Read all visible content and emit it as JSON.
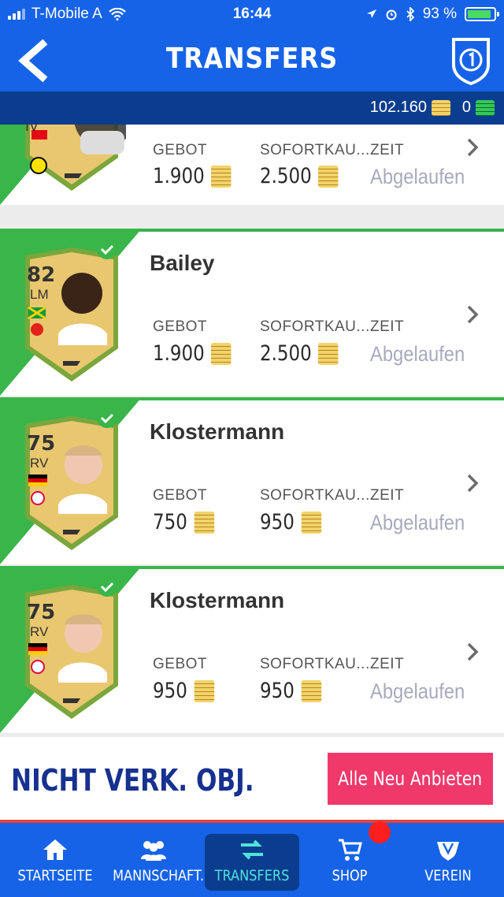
{
  "status": {
    "carrier": "T-Mobile A",
    "time": "16:44",
    "battery": "93 %"
  },
  "header": {
    "title": "TRANSFERS"
  },
  "currency": {
    "coins": "102.160",
    "points": "0"
  },
  "columns": {
    "bid": "GEBOT",
    "buy_now": "SOFORTKAU...",
    "time": "ZEIT"
  },
  "rows": [
    {
      "name": "",
      "rating": "",
      "position": "IV",
      "bid": "1.900",
      "buy_now": "2.500",
      "time": "Abgelaufen",
      "flag": "turkey"
    },
    {
      "name": "Bailey",
      "rating": "82",
      "position": "LM",
      "bid": "1.900",
      "buy_now": "2.500",
      "time": "Abgelaufen",
      "flag": "jamaica"
    },
    {
      "name": "Klostermann",
      "rating": "75",
      "position": "RV",
      "bid": "750",
      "buy_now": "950",
      "time": "Abgelaufen",
      "flag": "germany"
    },
    {
      "name": "Klostermann",
      "rating": "75",
      "position": "RV",
      "bid": "950",
      "buy_now": "950",
      "time": "Abgelaufen",
      "flag": "germany"
    }
  ],
  "unsold": {
    "title": "NICHT VERK. OBJ.",
    "button": "Alle Neu Anbieten"
  },
  "tabs": [
    {
      "label": "STARTSEITE",
      "icon": "home-icon"
    },
    {
      "label": "MANNSCHAFT.",
      "icon": "team-icon"
    },
    {
      "label": "TRANSFERS",
      "icon": "transfer-arrows-icon"
    },
    {
      "label": "SHOP",
      "icon": "cart-icon"
    },
    {
      "label": "VEREIN",
      "icon": "club-icon"
    }
  ],
  "colors": {
    "primary": "#1663e8",
    "dark": "#0b3d8f",
    "green": "#39b54a",
    "pink": "#f0386b"
  }
}
